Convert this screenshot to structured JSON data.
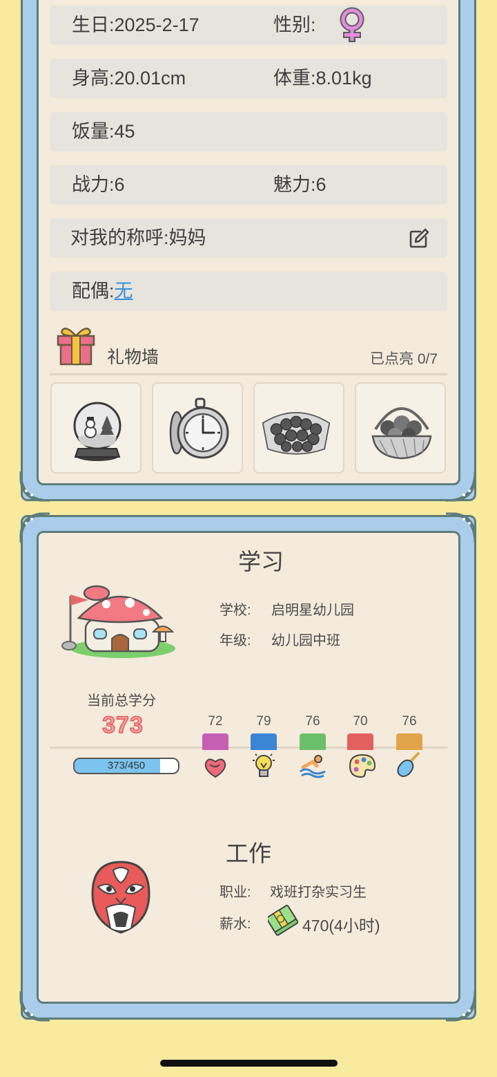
{
  "profile": {
    "birthday_label": "生日:",
    "birthday_value": "2025-2-17",
    "gender_label": "性别:",
    "gender_icon": "female-symbol-icon",
    "height_label": "身高:",
    "height_value": "20.01cm",
    "weight_label": "体重:",
    "weight_value": "8.01kg",
    "appetite_label": "饭量:",
    "appetite_value": "45",
    "combat_label": "战力:",
    "combat_value": "6",
    "charm_label": "魅力:",
    "charm_value": "6",
    "callme_label": "对我的称呼:",
    "callme_value": "妈妈",
    "spouse_label": "配偶:",
    "spouse_value": "无"
  },
  "gift_wall": {
    "title": "礼物墙",
    "lit_label": "已点亮",
    "lit_count": "0/7",
    "items": [
      {
        "icon": "snow-globe-icon"
      },
      {
        "icon": "pocket-watch-icon"
      },
      {
        "icon": "rose-bouquet-icon"
      },
      {
        "icon": "fruit-basket-icon"
      }
    ]
  },
  "study": {
    "title": "学习",
    "school_label": "学校:",
    "school_value": "启明星幼儿园",
    "grade_label": "年级:",
    "grade_value": "幼儿园中班",
    "credits_label": "当前总学分",
    "credits_value": "373",
    "progress_text": "373/450",
    "progress_fraction": 0.829,
    "subjects": [
      {
        "score": "72",
        "color": "#c45fb4",
        "icon": "heart-icon"
      },
      {
        "score": "79",
        "color": "#3a86d4",
        "icon": "lightbulb-icon"
      },
      {
        "score": "76",
        "color": "#6cbf6a",
        "icon": "swimmer-icon"
      },
      {
        "score": "70",
        "color": "#e2605f",
        "icon": "palette-icon"
      },
      {
        "score": "76",
        "color": "#e2a448",
        "icon": "shovel-icon"
      }
    ]
  },
  "work": {
    "title": "工作",
    "job_label": "职业:",
    "job_value": "戏班打杂实习生",
    "salary_label": "薪水:",
    "salary_value": "470(4小时)"
  },
  "colors": {
    "background": "#f8ea9f",
    "frame_blue": "#a9cdea",
    "card": "#f4ebdc",
    "row": "#e6e4dd",
    "credits_red": "#f07a7a"
  }
}
